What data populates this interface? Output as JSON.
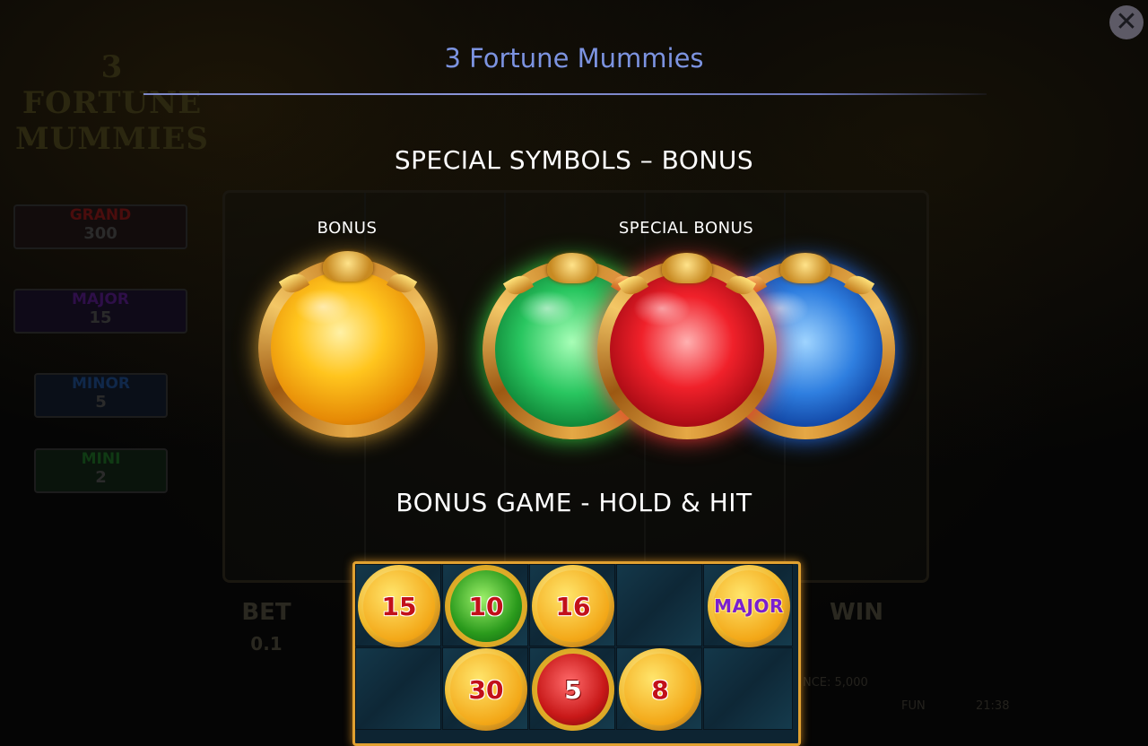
{
  "window": {
    "title": "3 Fortune Mummies",
    "close_icon": "close-icon"
  },
  "background_game": {
    "logo": [
      "3",
      "FORTUNE",
      "MUMMIES"
    ],
    "jackpots": [
      {
        "label": "GRAND",
        "value": "300",
        "color": "#6a1010"
      },
      {
        "label": "MAJOR",
        "value": "15",
        "color": "#3a1060"
      },
      {
        "label": "MINOR",
        "value": "5",
        "color": "#103a6a"
      },
      {
        "label": "MINI",
        "value": "2",
        "color": "#104a18"
      }
    ],
    "bet_label": "BET",
    "bet_value": "0.1",
    "win_label": "WIN",
    "balance_text": "NCE: 5,000",
    "mode_text": "FUN",
    "clock": "21:38"
  },
  "sections": {
    "special_symbols_heading": "SPECIAL SYMBOLS – BONUS",
    "bonus_label": "BONUS",
    "special_bonus_label": "SPECIAL BONUS",
    "bonus_game_heading": "BONUS GAME - HOLD & HIT"
  },
  "orbs": {
    "bonus": {
      "color": "gold",
      "accent": "#f5b321"
    },
    "special": [
      {
        "color": "green",
        "accent": "#3bc44a"
      },
      {
        "color": "red",
        "accent": "#e0222c"
      },
      {
        "color": "blue",
        "accent": "#2e7ce6"
      }
    ]
  },
  "grid": {
    "row1": [
      {
        "type": "gold",
        "text": "15"
      },
      {
        "type": "green",
        "text": "10"
      },
      {
        "type": "gold",
        "text": "16"
      },
      {
        "type": "empty",
        "text": ""
      },
      {
        "type": "gold-major",
        "text": "MAJOR"
      }
    ],
    "row2": [
      {
        "type": "empty",
        "text": ""
      },
      {
        "type": "gold",
        "text": "30"
      },
      {
        "type": "red",
        "text": "5"
      },
      {
        "type": "gold",
        "text": "8"
      },
      {
        "type": "empty",
        "text": ""
      }
    ]
  }
}
